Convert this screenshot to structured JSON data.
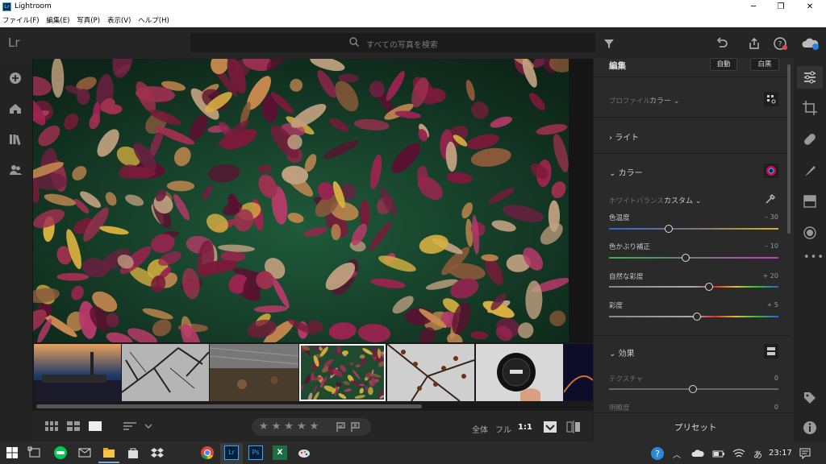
{
  "window": {
    "title": "Lightroom",
    "minimize": "─",
    "maximize": "❐",
    "close": "✕"
  },
  "menu": [
    "ファイル(F)",
    "編集(E)",
    "写真(P)",
    "表示(V)",
    "ヘルプ(H)"
  ],
  "app": {
    "logo": "Lr",
    "logo_badge": "Lr"
  },
  "search": {
    "placeholder": "すべての写真を検索"
  },
  "bottom": {
    "view_all": "全体",
    "view_full": "フル",
    "view_1to1": "1:1",
    "preset": "プリセット"
  },
  "panel": {
    "title": "編集",
    "auto": "自動",
    "bw": "白黒",
    "profile_label": "プロファイル",
    "profile_value": "カラー",
    "light": "ライト",
    "color": "カラー",
    "wb_label": "ホワイトバランス",
    "wb_value": "カスタム",
    "sliders": [
      {
        "label": "色温度",
        "value": "– 30"
      },
      {
        "label": "色かぶり補正",
        "value": "– 10"
      },
      {
        "label": "自然な彩度",
        "value": "+ 20"
      },
      {
        "label": "彩度",
        "value": "+ 5"
      }
    ],
    "effects": "効果",
    "texture_label": "テクスチャ",
    "texture_value": "0",
    "clarity_label": "明瞭度",
    "clarity_value": "0"
  },
  "taskbar": {
    "time": "23:17",
    "lang": "あ",
    "ps": "Ps",
    "lr": "Lr",
    "xl": "X"
  },
  "icons": [
    "search-icon",
    "filter-icon",
    "undo-icon",
    "share-icon",
    "help-icon",
    "cloud-sync-icon",
    "add-icon",
    "home-icon",
    "library-icon",
    "people-icon",
    "edit-sliders-icon",
    "crop-icon",
    "healing-icon",
    "brush-icon",
    "gradient-icon",
    "radial-icon",
    "more-icon",
    "tag-icon",
    "info-icon"
  ]
}
